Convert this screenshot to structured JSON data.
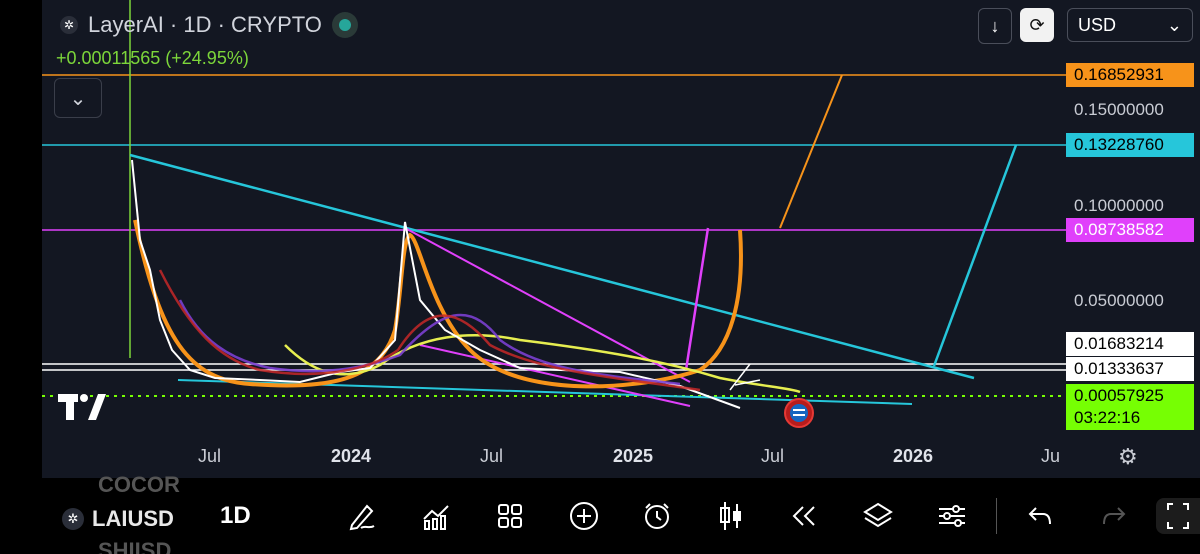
{
  "header": {
    "title": "LayerAI · 1D · CRYPTO",
    "change": "+0.00011565 (+24.95%)",
    "currency": "USD"
  },
  "price_labels": [
    {
      "text": "0.16852931",
      "bg": "#f7931a",
      "fg": "#000000"
    },
    {
      "text": "0.15000000",
      "bg": "",
      "fg": "#c9ccd4"
    },
    {
      "text": "0.13228760",
      "bg": "#26c6da",
      "fg": "#000000"
    },
    {
      "text": "0.10000000",
      "bg": "",
      "fg": "#c9ccd4"
    },
    {
      "text": "0.08738582",
      "bg": "#e040fb",
      "fg": "#ffffff"
    },
    {
      "text": "0.05000000",
      "bg": "",
      "fg": "#c9ccd4"
    },
    {
      "text": "0.01683214",
      "bg": "#ffffff",
      "fg": "#000000"
    },
    {
      "text": "0.01333637",
      "bg": "#ffffff",
      "fg": "#000000"
    },
    {
      "text": "0.00057925",
      "bg": "#76ff03",
      "fg": "#000000"
    },
    {
      "text": "03:22:16",
      "bg": "#76ff03",
      "fg": "#000000"
    }
  ],
  "x_axis": [
    "Jul",
    "2024",
    "Jul",
    "2025",
    "Jul",
    "2026",
    "Ju"
  ],
  "toolbar": {
    "symbol": "LAIUSD",
    "interval": "1D",
    "ghost_top": "COCOR",
    "ghost_bottom": "SHIISD",
    "tools": [
      "draw-tool",
      "indicators",
      "layouts",
      "add",
      "alert",
      "bar-style",
      "replay",
      "layers",
      "settings",
      "undo",
      "redo",
      "fullscreen"
    ]
  },
  "colors": {
    "orange": "#f7931a",
    "cyan": "#26c6da",
    "magenta": "#e040fb",
    "green": "#76ff03",
    "yellow": "#e6ee50",
    "background": "#131722"
  }
}
